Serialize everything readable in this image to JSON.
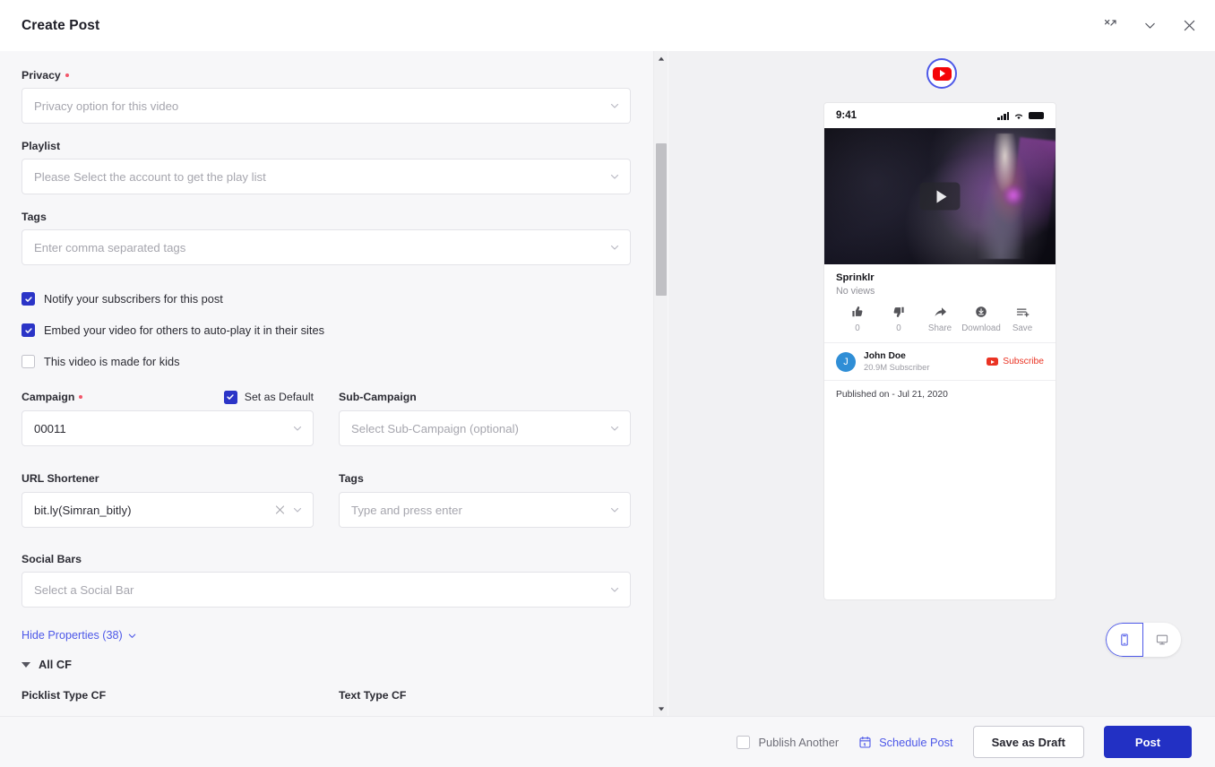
{
  "header": {
    "title": "Create Post",
    "icons": [
      {
        "name": "collapse-icon"
      },
      {
        "name": "chevron-down-icon"
      },
      {
        "name": "close-icon"
      }
    ]
  },
  "form": {
    "privacy": {
      "label": "Privacy",
      "required": true,
      "placeholder": "Privacy option for this video",
      "value": ""
    },
    "playlist": {
      "label": "Playlist",
      "required": false,
      "placeholder": "Please Select the account to get the play list",
      "value": ""
    },
    "tags_top": {
      "label": "Tags",
      "required": false,
      "placeholder": "Enter comma separated tags",
      "value": ""
    },
    "checkboxes": [
      {
        "label": "Notify your subscribers for this post",
        "checked": true
      },
      {
        "label": "Embed your video for others to auto-play it in their sites",
        "checked": true
      },
      {
        "label": "This video is made for kids",
        "checked": false
      }
    ],
    "campaign": {
      "label": "Campaign",
      "required": true,
      "value": "00011",
      "placeholder": ""
    },
    "set_as_default": {
      "label": "Set as Default",
      "checked": true
    },
    "sub_campaign": {
      "label": "Sub-Campaign",
      "required": false,
      "placeholder": "Select Sub-Campaign (optional)",
      "value": ""
    },
    "url_shortener": {
      "label": "URL Shortener",
      "required": false,
      "value": "bit.ly(Simran_bitly)",
      "placeholder": ""
    },
    "tags_bottom": {
      "label": "Tags",
      "required": false,
      "placeholder": "Type and press enter",
      "value": ""
    },
    "social_bars": {
      "label": "Social Bars",
      "required": false,
      "placeholder": "Select a Social Bar",
      "value": ""
    },
    "hide_properties": "Hide Properties (38)",
    "all_cf_section": "All CF",
    "cf_fields": [
      {
        "label": "Picklist Type CF"
      },
      {
        "label": "Text Type CF"
      }
    ]
  },
  "preview": {
    "network_badge": "youtube-icon",
    "status_bar": {
      "time": "9:41"
    },
    "video": {
      "play_label": "play-icon"
    },
    "title": "Sprinklr",
    "views": "No views",
    "actions": [
      {
        "name": "like",
        "label": "0",
        "icon": "thumbs-up-icon"
      },
      {
        "name": "dislike",
        "label": "0",
        "icon": "thumbs-down-icon"
      },
      {
        "name": "share",
        "label": "Share",
        "icon": "share-icon"
      },
      {
        "name": "download",
        "label": "Download",
        "icon": "download-icon"
      },
      {
        "name": "save",
        "label": "Save",
        "icon": "save-to-playlist-icon"
      }
    ],
    "channel": {
      "avatar_letter": "J",
      "name": "John Doe",
      "subscribers": "20.9M Subscriber",
      "subscribe_label": "Subscribe"
    },
    "published": "Published on - Jul 21, 2020",
    "device_toggle": {
      "mobile": "mobile-view",
      "desktop": "desktop-view",
      "active": "mobile-view"
    }
  },
  "footer": {
    "publish_another": {
      "label": "Publish Another",
      "checked": false
    },
    "schedule_post": "Schedule Post",
    "save_as_draft": "Save as Draft",
    "post": "Post"
  },
  "colors": {
    "accent": "#2230c4",
    "link": "#4d58e8",
    "required": "#f2566a",
    "panel_bg": "#f7f7f9",
    "preview_bg": "#f1f1f3",
    "youtube_red": "#f40407"
  }
}
